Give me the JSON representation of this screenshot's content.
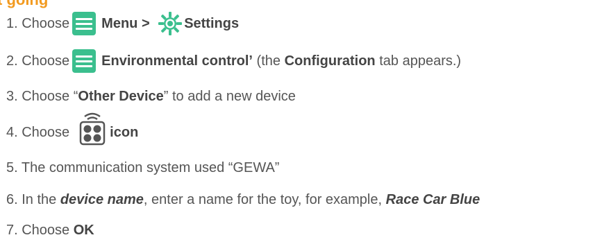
{
  "heading": "t going",
  "steps": [
    {
      "num": "1. Choose",
      "menu_text": "Menu > ",
      "settings_text": "Settings"
    },
    {
      "num": "2. Choose",
      "env_text": "Environmental control’",
      "paren_open": " (the ",
      "config_text": "Configuration",
      "paren_close": " tab appears.)"
    },
    {
      "num": "3. Choose “",
      "other_device": "Other Device",
      "rest": "” to add a new device"
    },
    {
      "num": "4. Choose",
      "icon_text": "icon"
    },
    {
      "text": "5. The communication system used “GEWA”"
    },
    {
      "prefix": "6. In the ",
      "device_name": "device name",
      "middle": ", enter a name for the toy, for example, ",
      "example": "Race Car Blue"
    },
    {
      "prefix": "7. Choose ",
      "ok": "OK"
    }
  ],
  "icons": {
    "menu": "menu-hamburger-icon",
    "settings": "gear-icon",
    "remote": "remote-control-icon"
  },
  "colors": {
    "heading": "#f29a1f",
    "menu_icon_bg": "#3bbf8e",
    "text": "#555555"
  }
}
